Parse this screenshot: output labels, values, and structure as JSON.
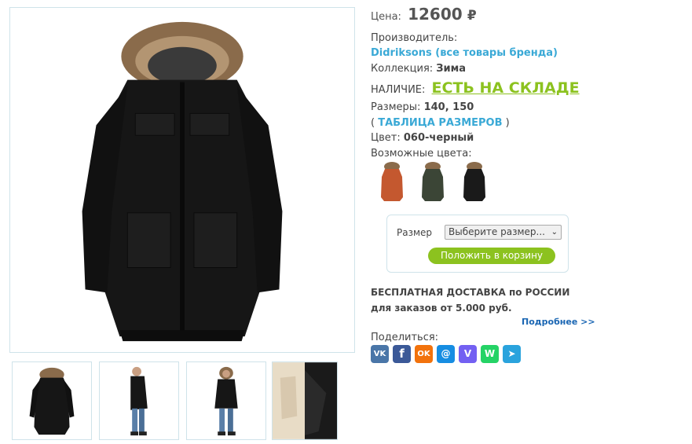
{
  "price": {
    "label": "Цена:",
    "value": "12600",
    "currency": "₽"
  },
  "manufacturer": {
    "label": "Производитель:",
    "brand_link": "Didriksons (все товары бренда)"
  },
  "collection": {
    "label": "Коллекция:",
    "value": "Зима"
  },
  "availability": {
    "label": "НАЛИЧИЕ:",
    "value": "ЕСТЬ НА СКЛАДЕ"
  },
  "sizes": {
    "label": "Размеры:",
    "value": "140, 150",
    "open_paren": "(",
    "table_link": "ТАБЛИЦА РАЗМЕРОВ",
    "close_paren": ")"
  },
  "color": {
    "label": "Цвет:",
    "value": "060-черный"
  },
  "available_colors": {
    "label": "Возможные цвета:",
    "swatches": [
      {
        "name": "orange",
        "hex": "#c4582f"
      },
      {
        "name": "dark-green",
        "hex": "#3b4536"
      },
      {
        "name": "black",
        "hex": "#1a1a1a"
      }
    ]
  },
  "cart": {
    "size_label": "Размер",
    "size_select_value": "Выберите размер...",
    "add_button": "Положить в корзину"
  },
  "delivery": {
    "line1": "БЕСПЛАТНАЯ ДОСТАВКА по РОССИИ",
    "line2": "для заказов от 5.000 руб.",
    "more": "Подробнее >>"
  },
  "share": {
    "label": "Поделиться:",
    "buttons": [
      {
        "name": "vk",
        "glyph": "VK",
        "color": "#4a76a8"
      },
      {
        "name": "facebook",
        "glyph": "f",
        "color": "#3b5998"
      },
      {
        "name": "odnoklassniki",
        "glyph": "OK",
        "color": "#f2720c"
      },
      {
        "name": "moimir",
        "glyph": "@",
        "color": "#168de2"
      },
      {
        "name": "viber",
        "glyph": "V",
        "color": "#7360f2"
      },
      {
        "name": "whatsapp",
        "glyph": "W",
        "color": "#25d366"
      },
      {
        "name": "telegram",
        "glyph": "➤",
        "color": "#2aa3dd"
      }
    ]
  },
  "colors": {
    "accent_green": "#8cc21f",
    "link_blue": "#3aa9d6",
    "border": "#cfe3ea"
  }
}
